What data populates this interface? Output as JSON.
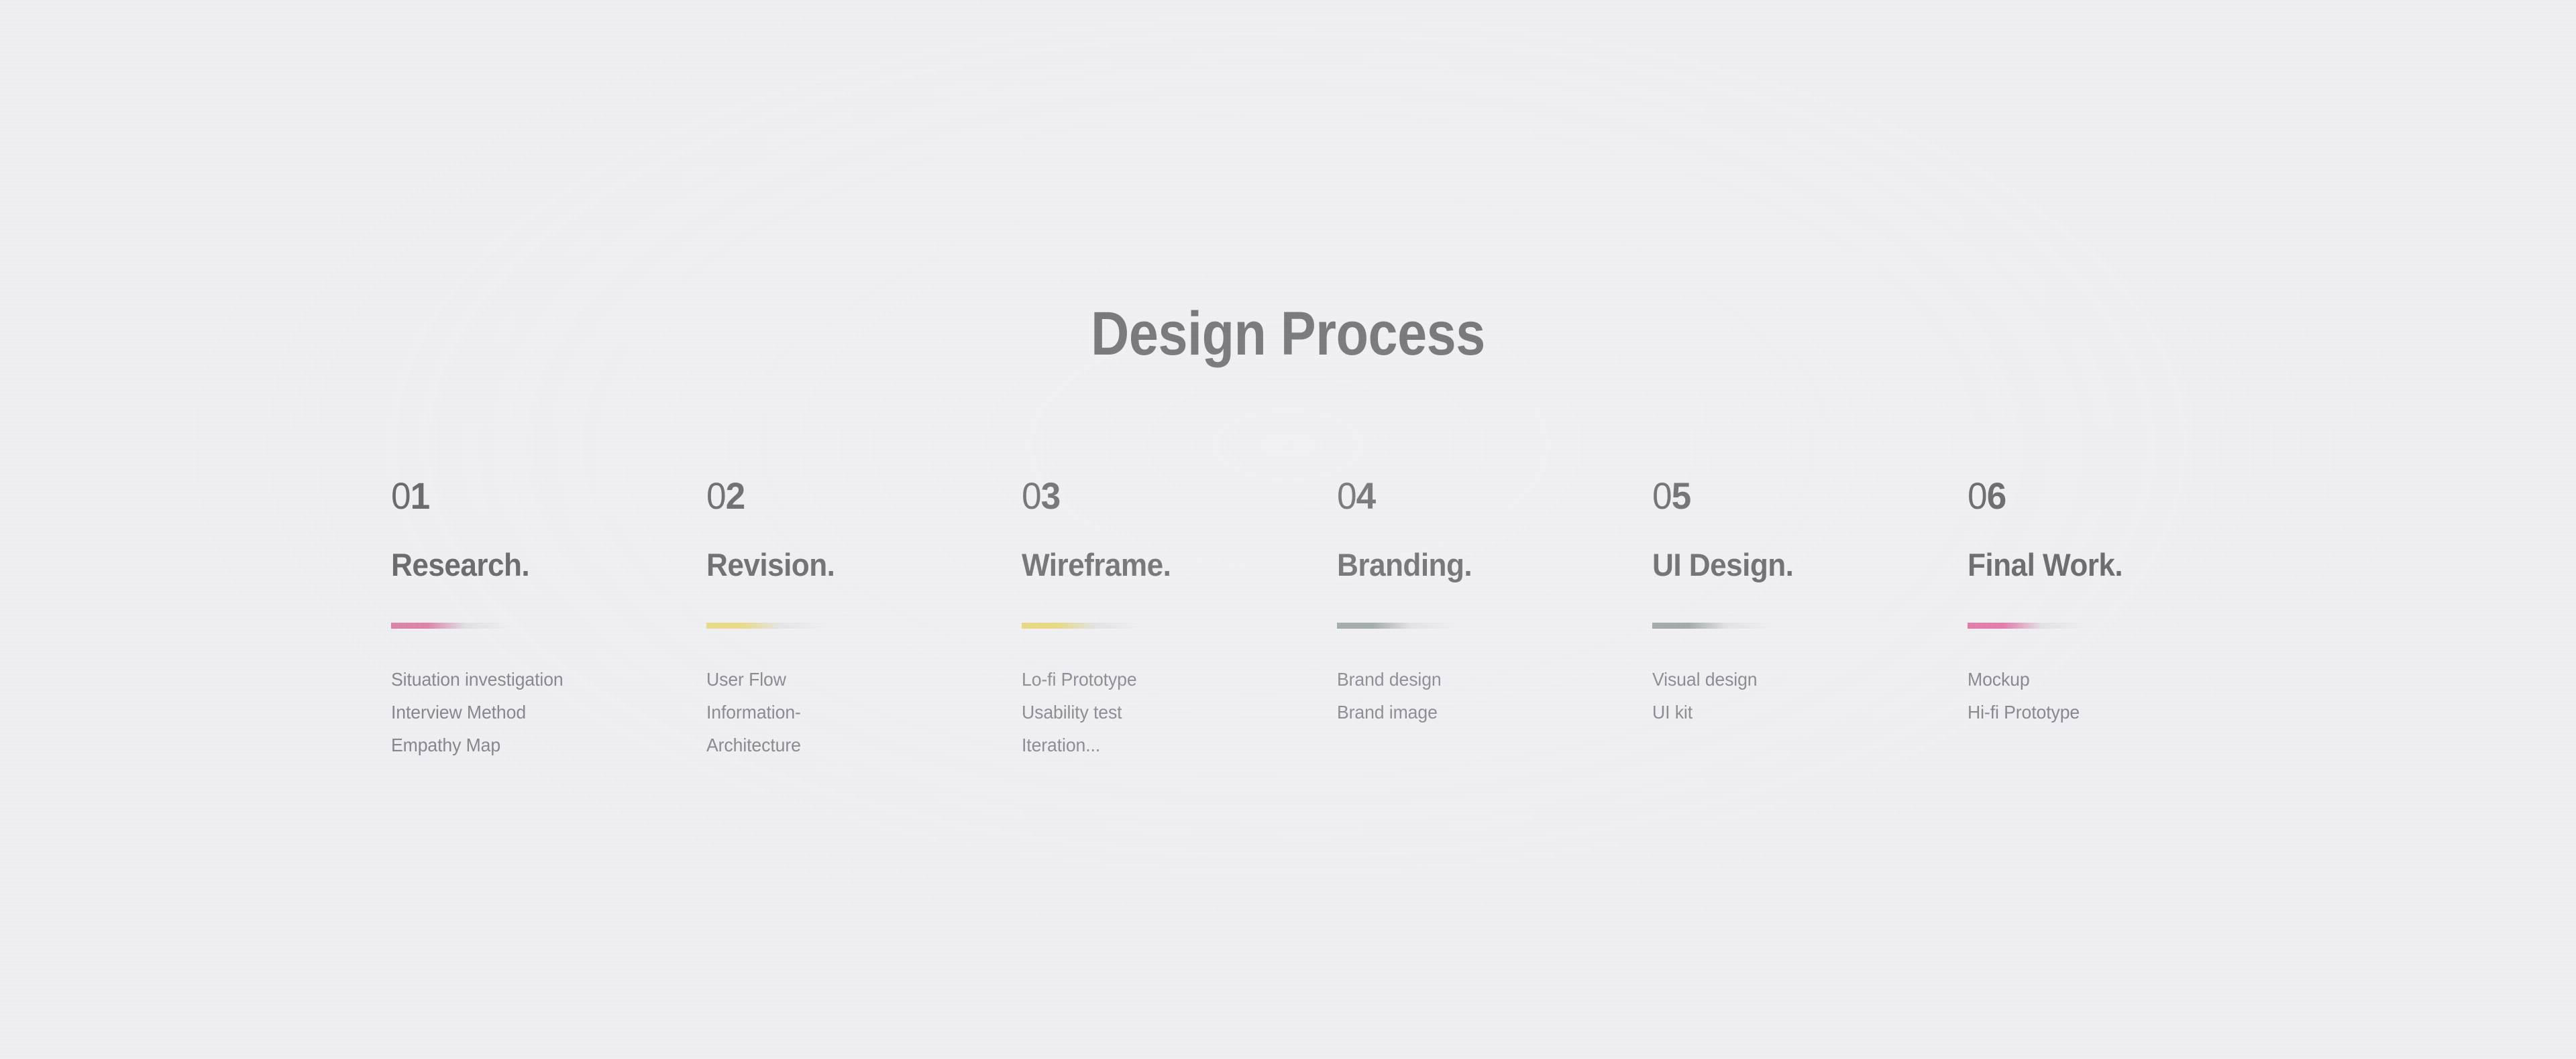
{
  "page": {
    "title": "Design Process",
    "background_color": "#eeeef2",
    "title_color": "#1f2023",
    "body_text_color": "#4a4d53"
  },
  "steps": [
    {
      "number_prefix": "0",
      "number_digit": "1",
      "number": "01",
      "heading": "Research.",
      "bar_color": "#d0467f",
      "bar_fade_color": "#d6d6da",
      "lines": [
        "Situation investigation",
        "Interview Method",
        "Empathy Map"
      ]
    },
    {
      "number_prefix": "0",
      "number_digit": "2",
      "number": "02",
      "heading": "Revision.",
      "bar_color": "#e3cc47",
      "bar_fade_color": "#dcdce0",
      "lines": [
        "User Flow",
        "Information-",
        "Architecture"
      ]
    },
    {
      "number_prefix": "0",
      "number_digit": "3",
      "number": "03",
      "heading": "Wireframe.",
      "bar_color": "#e0c838",
      "bar_fade_color": "#d8d8dd",
      "lines": [
        "Lo-fi Prototype",
        "Usability test",
        "Iteration..."
      ]
    },
    {
      "number_prefix": "0",
      "number_digit": "4",
      "number": "04",
      "heading": "Branding.",
      "bar_color": "#6e7b76",
      "bar_fade_color": "#d9d8d6",
      "lines": [
        "Brand design",
        "Brand image"
      ]
    },
    {
      "number_prefix": "0",
      "number_digit": "5",
      "number": "05",
      "heading": "UI Design.",
      "bar_color": "#6e7b76",
      "bar_fade_color": "#d9d8d6",
      "lines": [
        "Visual design",
        "UI kit"
      ]
    },
    {
      "number_prefix": "0",
      "number_digit": "6",
      "number": "06",
      "heading": "Final Work.",
      "bar_color": "#d8377e",
      "bar_fade_color": "#d9d9dd",
      "lines": [
        "Mockup",
        "Hi-fi Prototype"
      ]
    }
  ]
}
